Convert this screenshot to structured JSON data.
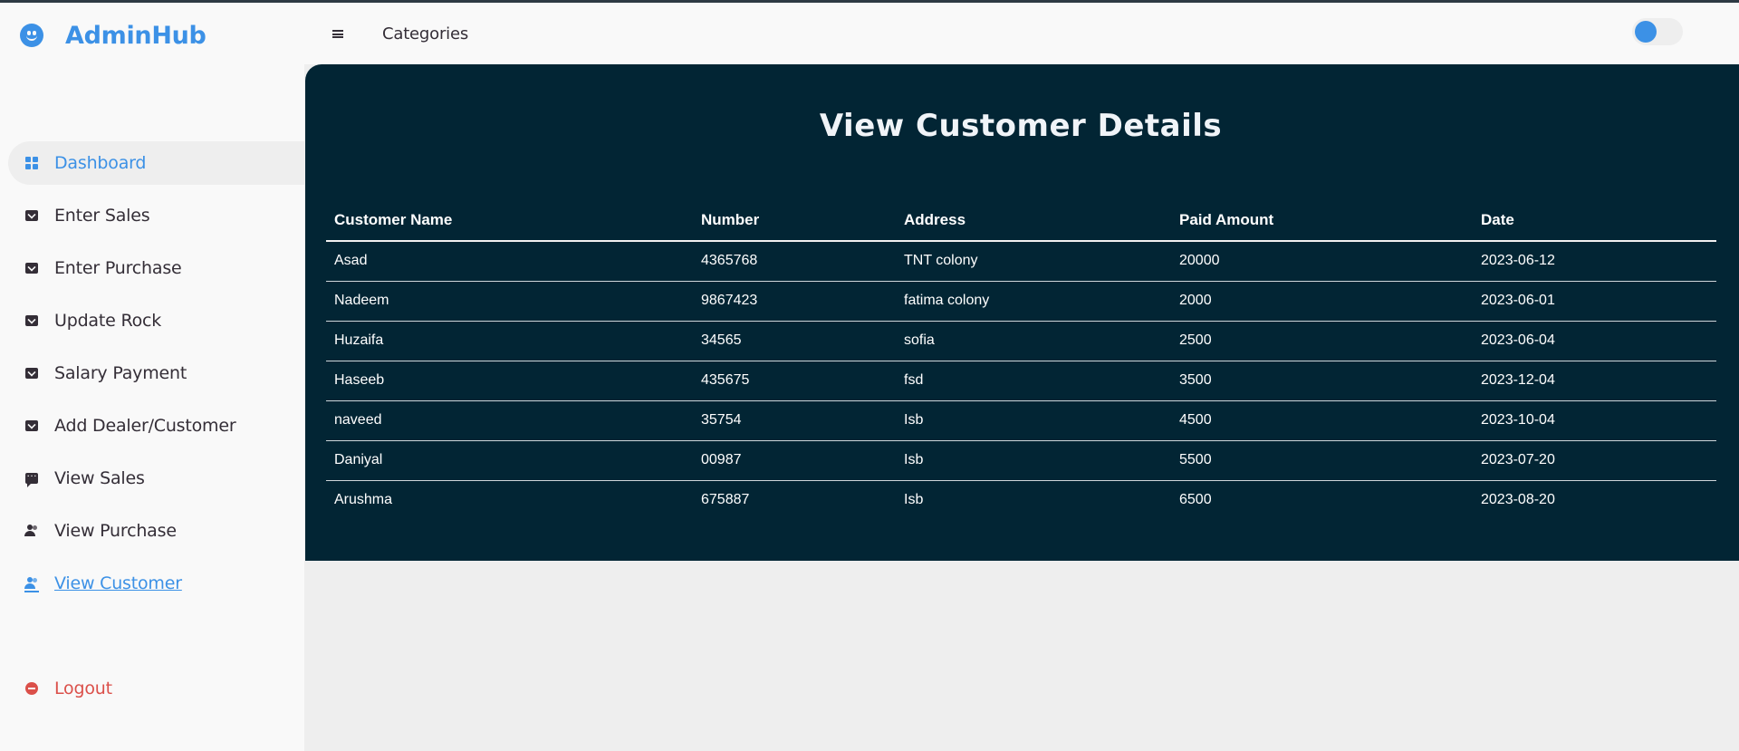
{
  "app": {
    "title": "AdminHub"
  },
  "navbar": {
    "menu_label": "Categories"
  },
  "sidebar": {
    "items": [
      {
        "label": "Dashboard"
      },
      {
        "label": "Enter Sales"
      },
      {
        "label": "Enter Purchase"
      },
      {
        "label": "Update Rock"
      },
      {
        "label": "Salary Payment"
      },
      {
        "label": "Add Dealer/Customer"
      },
      {
        "label": "View Sales"
      },
      {
        "label": "View Purchase"
      },
      {
        "label": "View Customer"
      }
    ],
    "logout": "Logout"
  },
  "main": {
    "title": "View Customer Details",
    "table": {
      "headers": [
        "Customer Name",
        "Number",
        "Address",
        "Paid Amount",
        "Date"
      ],
      "rows": [
        [
          "Asad",
          "4365768",
          "TNT colony",
          "20000",
          "2023-06-12"
        ],
        [
          "Nadeem",
          "9867423",
          "fatima colony",
          "2000",
          "2023-06-01"
        ],
        [
          "Huzaifa",
          "34565",
          "sofia",
          "2500",
          "2023-06-04"
        ],
        [
          "Haseeb",
          "435675",
          "fsd",
          "3500",
          "2023-12-04"
        ],
        [
          "naveed",
          "35754",
          "Isb",
          "4500",
          "2023-10-04"
        ],
        [
          "Daniyal",
          "00987",
          "Isb",
          "5500",
          "2023-07-20"
        ],
        [
          "Arushma",
          "675887",
          "Isb",
          "6500",
          "2023-08-20"
        ]
      ]
    }
  },
  "theme": {
    "accent": "#3c91e6",
    "panel_bg": "#022534",
    "danger": "#db504a",
    "dark_mode_toggle": "off"
  }
}
